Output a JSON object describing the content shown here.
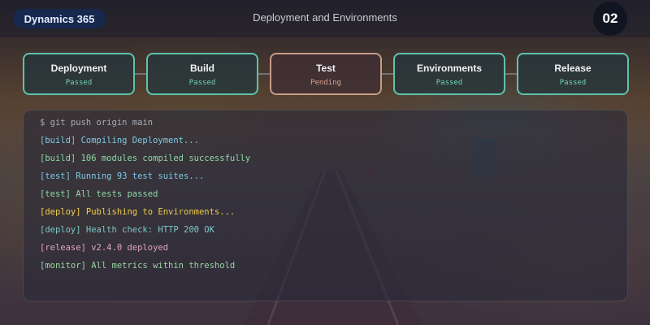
{
  "header": {
    "brand": "Dynamics 365",
    "title": "Deployment and Environments",
    "step_number": "02"
  },
  "pipeline": {
    "stages": [
      {
        "name": "Deployment",
        "status": "Passed"
      },
      {
        "name": "Build",
        "status": "Passed"
      },
      {
        "name": "Test",
        "status": "Pending"
      },
      {
        "name": "Environments",
        "status": "Passed"
      },
      {
        "name": "Release",
        "status": "Passed"
      }
    ]
  },
  "terminal": {
    "lines": [
      "$ git push origin main",
      "[build] Compiling Deployment...",
      "[build] 106 modules compiled successfully",
      "[test] Running 93 test suites...",
      "[test] All tests passed",
      "[deploy] Publishing to Environments...",
      "[deploy] Health check: HTTP 200 OK",
      "[release] v2.4.0 deployed",
      "[monitor] All metrics within threshold"
    ]
  },
  "colors": {
    "passed_border": "#5fc2ad",
    "pending_border": "#c99a88",
    "brand_pill": "#16284e"
  }
}
